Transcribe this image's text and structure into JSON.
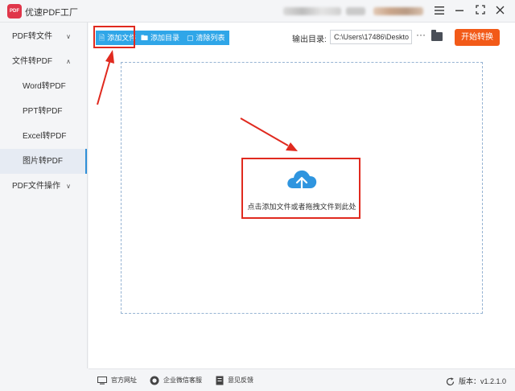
{
  "app": {
    "logo_text": "PDF",
    "title": "优速PDF工厂"
  },
  "window": {
    "menu_icon": "hamburger-icon",
    "minimize_icon": "minimize-icon",
    "maximize_icon": "maximize-icon",
    "close_icon": "close-icon"
  },
  "sidebar": {
    "items": [
      {
        "label": "PDF转文件",
        "level": "top",
        "expanded": false
      },
      {
        "label": "文件转PDF",
        "level": "top",
        "expanded": true
      },
      {
        "label": "Word转PDF",
        "level": "sub"
      },
      {
        "label": "PPT转PDF",
        "level": "sub"
      },
      {
        "label": "Excel转PDF",
        "level": "sub"
      },
      {
        "label": "图片转PDF",
        "level": "sub",
        "active": true
      },
      {
        "label": "PDF文件操作",
        "level": "top",
        "expanded": false
      }
    ]
  },
  "toolbar": {
    "add_file": "添加文件",
    "add_folder": "添加目录",
    "clear_list": "清除列表",
    "output_label": "输出目录:",
    "output_path": "C:\\Users\\17486\\Deskto",
    "more": "···",
    "start": "开始转换"
  },
  "dropzone": {
    "hint": "点击添加文件或者拖拽文件到此处",
    "icon": "cloud-upload-icon"
  },
  "footer": {
    "website": "官方网址",
    "wechat": "企业微信客服",
    "feedback": "意见反馈",
    "version": "版本：v1.2.1.0"
  },
  "colors": {
    "accent_blue": "#2fa6e8",
    "start_orange": "#f25a18",
    "annotation_red": "#e02a1f",
    "logo_red": "#e0364a"
  }
}
